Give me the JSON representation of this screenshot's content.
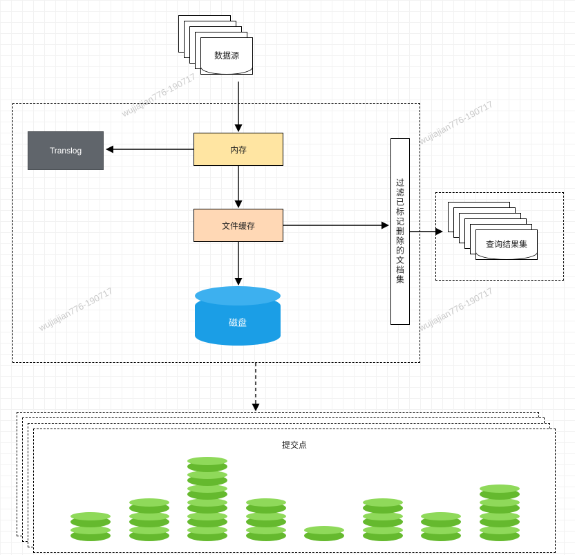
{
  "watermark": "wujiajian776-190717",
  "nodes": {
    "datasource": "数据源",
    "translog": "Translog",
    "memory": "内存",
    "filecache": "文件缓存",
    "filter": "过滤已标记删除的文档集",
    "disk": "磁盘",
    "resultset": "查询结果集",
    "commitpoint": "提交点"
  },
  "commit_stacks": [
    2,
    3,
    6,
    3,
    1,
    3,
    2,
    4
  ]
}
